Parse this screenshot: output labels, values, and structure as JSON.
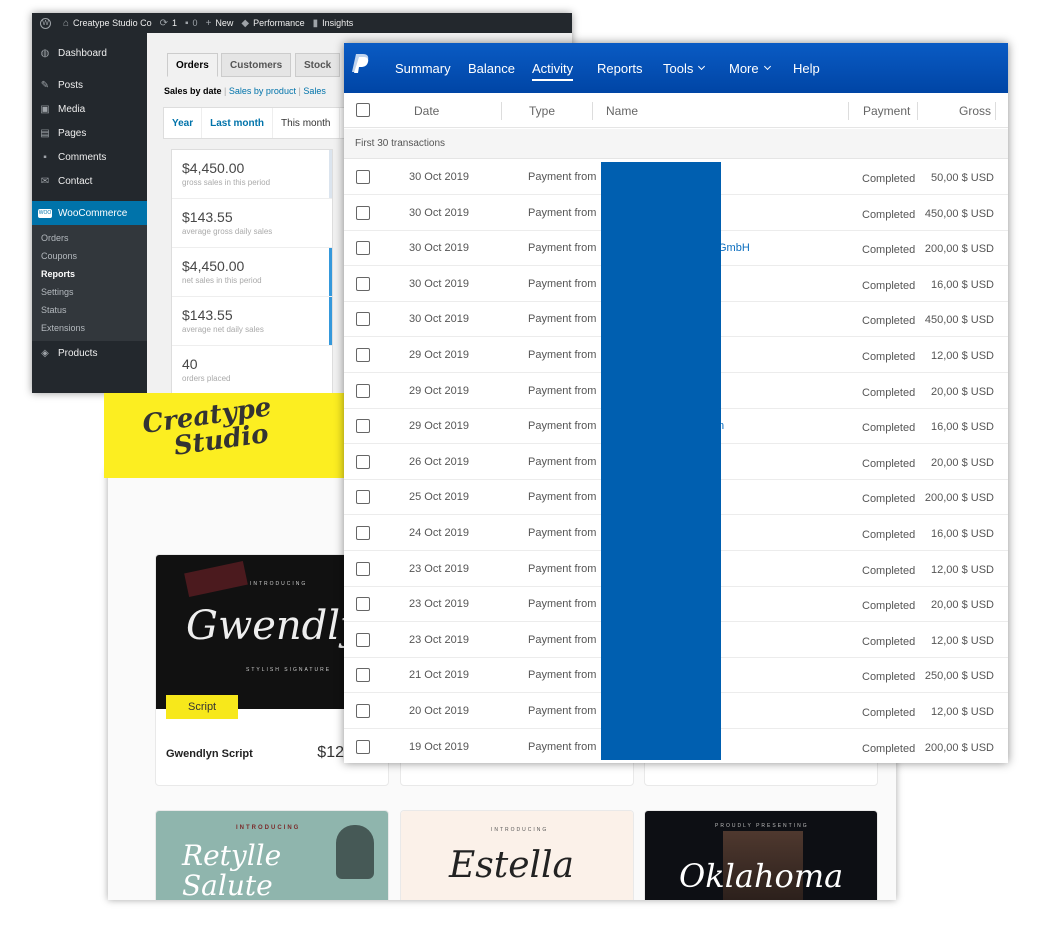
{
  "wp": {
    "adminbar": [
      {
        "icon": "wordpress-logo-icon",
        "label": ""
      },
      {
        "icon": "home-icon",
        "label": "Creatype Studio Co"
      },
      {
        "icon": "updates-icon",
        "label": "1"
      },
      {
        "icon": "comments-icon",
        "label": "0"
      },
      {
        "icon": "plus-icon",
        "label": "New"
      },
      {
        "icon": "performance-icon",
        "label": "Performance"
      },
      {
        "icon": "insights-icon",
        "label": "Insights"
      }
    ],
    "menu_top": [
      {
        "label": "Dashboard"
      }
    ],
    "menu_mid": [
      {
        "label": "Posts"
      },
      {
        "label": "Media"
      },
      {
        "label": "Pages"
      },
      {
        "label": "Comments"
      },
      {
        "label": "Contact"
      }
    ],
    "woo": "WooCommerce",
    "woo_badge": "WOO",
    "submenu": [
      "Orders",
      "Coupons",
      "Reports",
      "Settings",
      "Status",
      "Extensions"
    ],
    "products": "Products",
    "tabs": [
      "Orders",
      "Customers",
      "Stock"
    ],
    "subnav": {
      "current": "Sales by date",
      "sep": "|",
      "product": "Sales by product",
      "more": "Sales"
    },
    "range": [
      "Year",
      "Last month",
      "This month"
    ],
    "stats": [
      {
        "value": "$4,450.00",
        "label": "gross sales in this period"
      },
      {
        "value": "$143.55",
        "label": "average gross daily sales"
      },
      {
        "value": "$4,450.00",
        "label": "net sales in this period"
      },
      {
        "value": "$143.55",
        "label": "average net daily sales"
      },
      {
        "value": "40",
        "label": "orders placed"
      }
    ]
  },
  "brand": {
    "logo_line1": "Creatype",
    "logo_line2": "Studio"
  },
  "shop": {
    "card1": {
      "image_top": "INTRODUCING",
      "image_title": "Gwendlyn",
      "image_sub": "STYLISH SIGNATURE",
      "badge": "Script",
      "title": "Gwendlyn Script",
      "price": "$12"
    },
    "card4": {
      "image_top": "INTRODUCING",
      "image_title": "Retylle Salute"
    },
    "card5": {
      "image_top": "INTRODUCING",
      "image_title": "Estella"
    },
    "card6": {
      "image_top": "PROUDLY PRESENTING",
      "image_title": "Oklahoma"
    }
  },
  "paypal": {
    "nav": [
      {
        "label": "Summary"
      },
      {
        "label": "Balance"
      },
      {
        "label": "Activity"
      },
      {
        "label": "Reports"
      },
      {
        "label": "Tools"
      },
      {
        "label": "More"
      },
      {
        "label": "Help"
      }
    ],
    "columns": {
      "date": "Date",
      "type": "Type",
      "name": "Name",
      "payment": "Payment",
      "gross": "Gross"
    },
    "subheader": "First 30 transactions",
    "rows": [
      {
        "date": "30 Oct 2019",
        "type": "Payment from",
        "name": "",
        "status": "Completed",
        "gross": "50,00 $ USD"
      },
      {
        "date": "30 Oct 2019",
        "type": "Payment from",
        "name": "",
        "status": "Completed",
        "gross": "450,00 $ USD"
      },
      {
        "date": "30 Oct 2019",
        "type": "Payment from",
        "name": "GmbH",
        "status": "Completed",
        "gross": "200,00 $ USD"
      },
      {
        "date": "30 Oct 2019",
        "type": "Payment from",
        "name": "",
        "status": "Completed",
        "gross": "16,00 $ USD"
      },
      {
        "date": "30 Oct 2019",
        "type": "Payment from",
        "name": "",
        "status": "Completed",
        "gross": "450,00 $ USD"
      },
      {
        "date": "29 Oct 2019",
        "type": "Payment from",
        "name": "",
        "status": "Completed",
        "gross": "12,00 $ USD"
      },
      {
        "date": "29 Oct 2019",
        "type": "Payment from",
        "name": "",
        "status": "Completed",
        "gross": "20,00 $ USD"
      },
      {
        "date": "29 Oct 2019",
        "type": "Payment from",
        "name": "n",
        "status": "Completed",
        "gross": "16,00 $ USD"
      },
      {
        "date": "26 Oct 2019",
        "type": "Payment from",
        "name": "",
        "status": "Completed",
        "gross": "20,00 $ USD"
      },
      {
        "date": "25 Oct 2019",
        "type": "Payment from",
        "name": "",
        "status": "Completed",
        "gross": "200,00 $ USD"
      },
      {
        "date": "24 Oct 2019",
        "type": "Payment from",
        "name": "",
        "status": "Completed",
        "gross": "16,00 $ USD"
      },
      {
        "date": "23 Oct 2019",
        "type": "Payment from",
        "name": "",
        "status": "Completed",
        "gross": "12,00 $ USD"
      },
      {
        "date": "23 Oct 2019",
        "type": "Payment from",
        "name": "",
        "status": "Completed",
        "gross": "20,00 $ USD"
      },
      {
        "date": "23 Oct 2019",
        "type": "Payment from",
        "name": "",
        "status": "Completed",
        "gross": "12,00 $ USD"
      },
      {
        "date": "21 Oct 2019",
        "type": "Payment from",
        "name": "",
        "status": "Completed",
        "gross": "250,00 $ USD"
      },
      {
        "date": "20 Oct 2019",
        "type": "Payment from",
        "name": "",
        "status": "Completed",
        "gross": "12,00 $ USD"
      },
      {
        "date": "19 Oct 2019",
        "type": "Payment from",
        "name": "",
        "status": "Completed",
        "gross": "200,00 $ USD"
      }
    ]
  },
  "colors": {
    "wp_dark": "#23282d",
    "wp_blue": "#0073aa",
    "paypal_blue": "#0a5bc4",
    "brand_yellow": "#fcee21",
    "redaction": "#005fb0"
  }
}
